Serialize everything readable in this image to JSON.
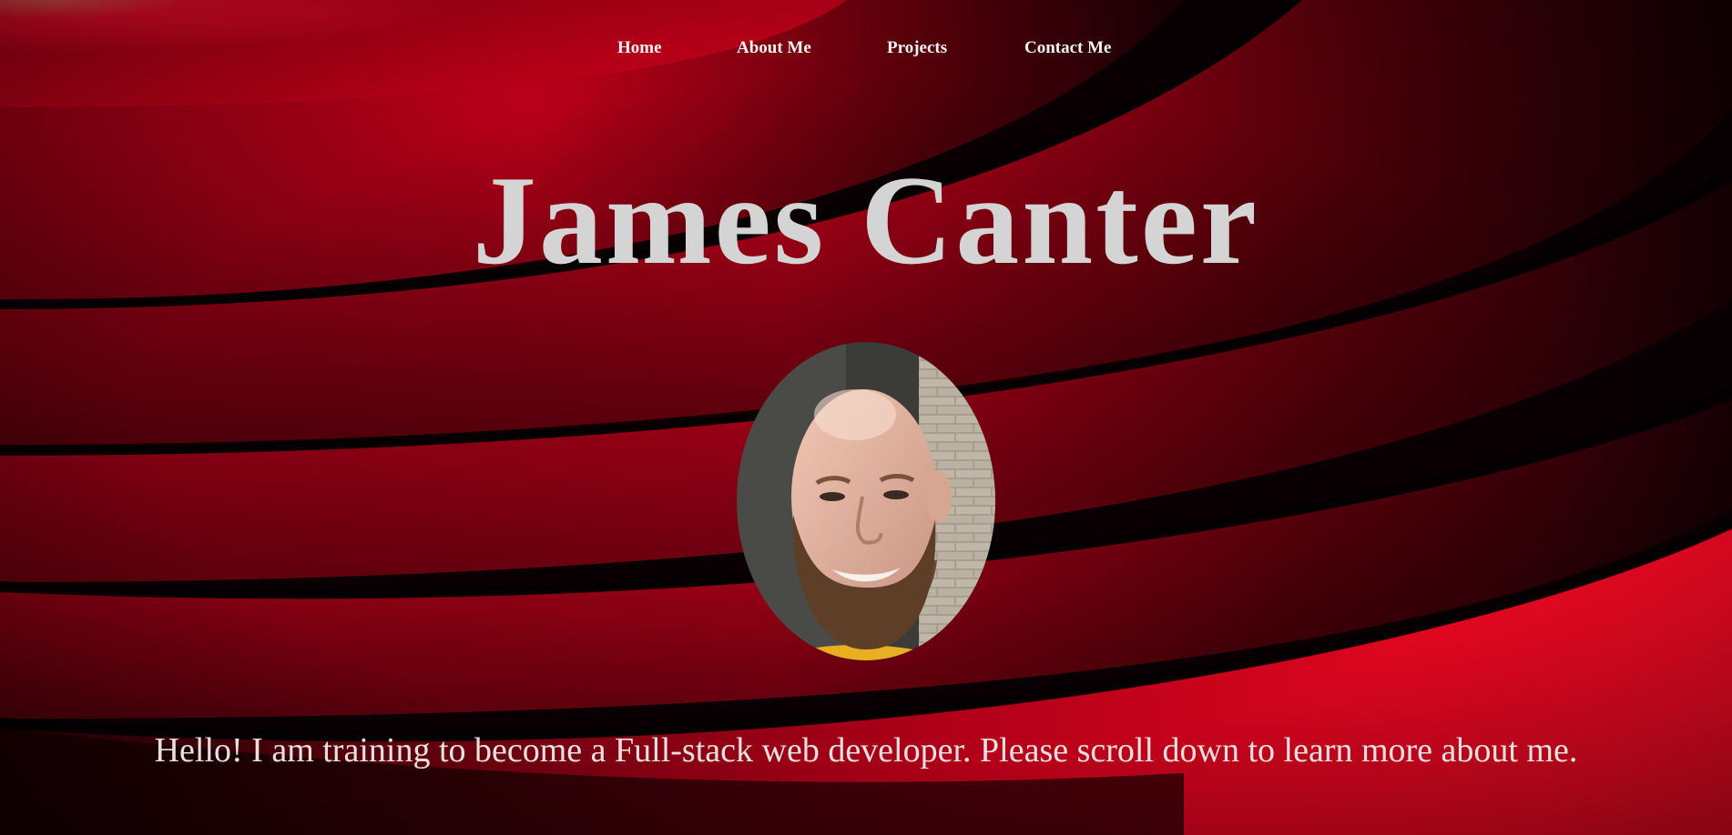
{
  "nav": {
    "items": [
      {
        "label": "Home"
      },
      {
        "label": "About Me"
      },
      {
        "label": "Projects"
      },
      {
        "label": "Contact Me"
      }
    ]
  },
  "hero": {
    "title": "James Canter",
    "intro": "Hello! I am training to become a Full-stack web developer. Please scroll down to learn more about me."
  },
  "colors": {
    "accent_red": "#e0001f",
    "background_dark": "#0a0003",
    "title_gray": "#d4d4d4"
  }
}
